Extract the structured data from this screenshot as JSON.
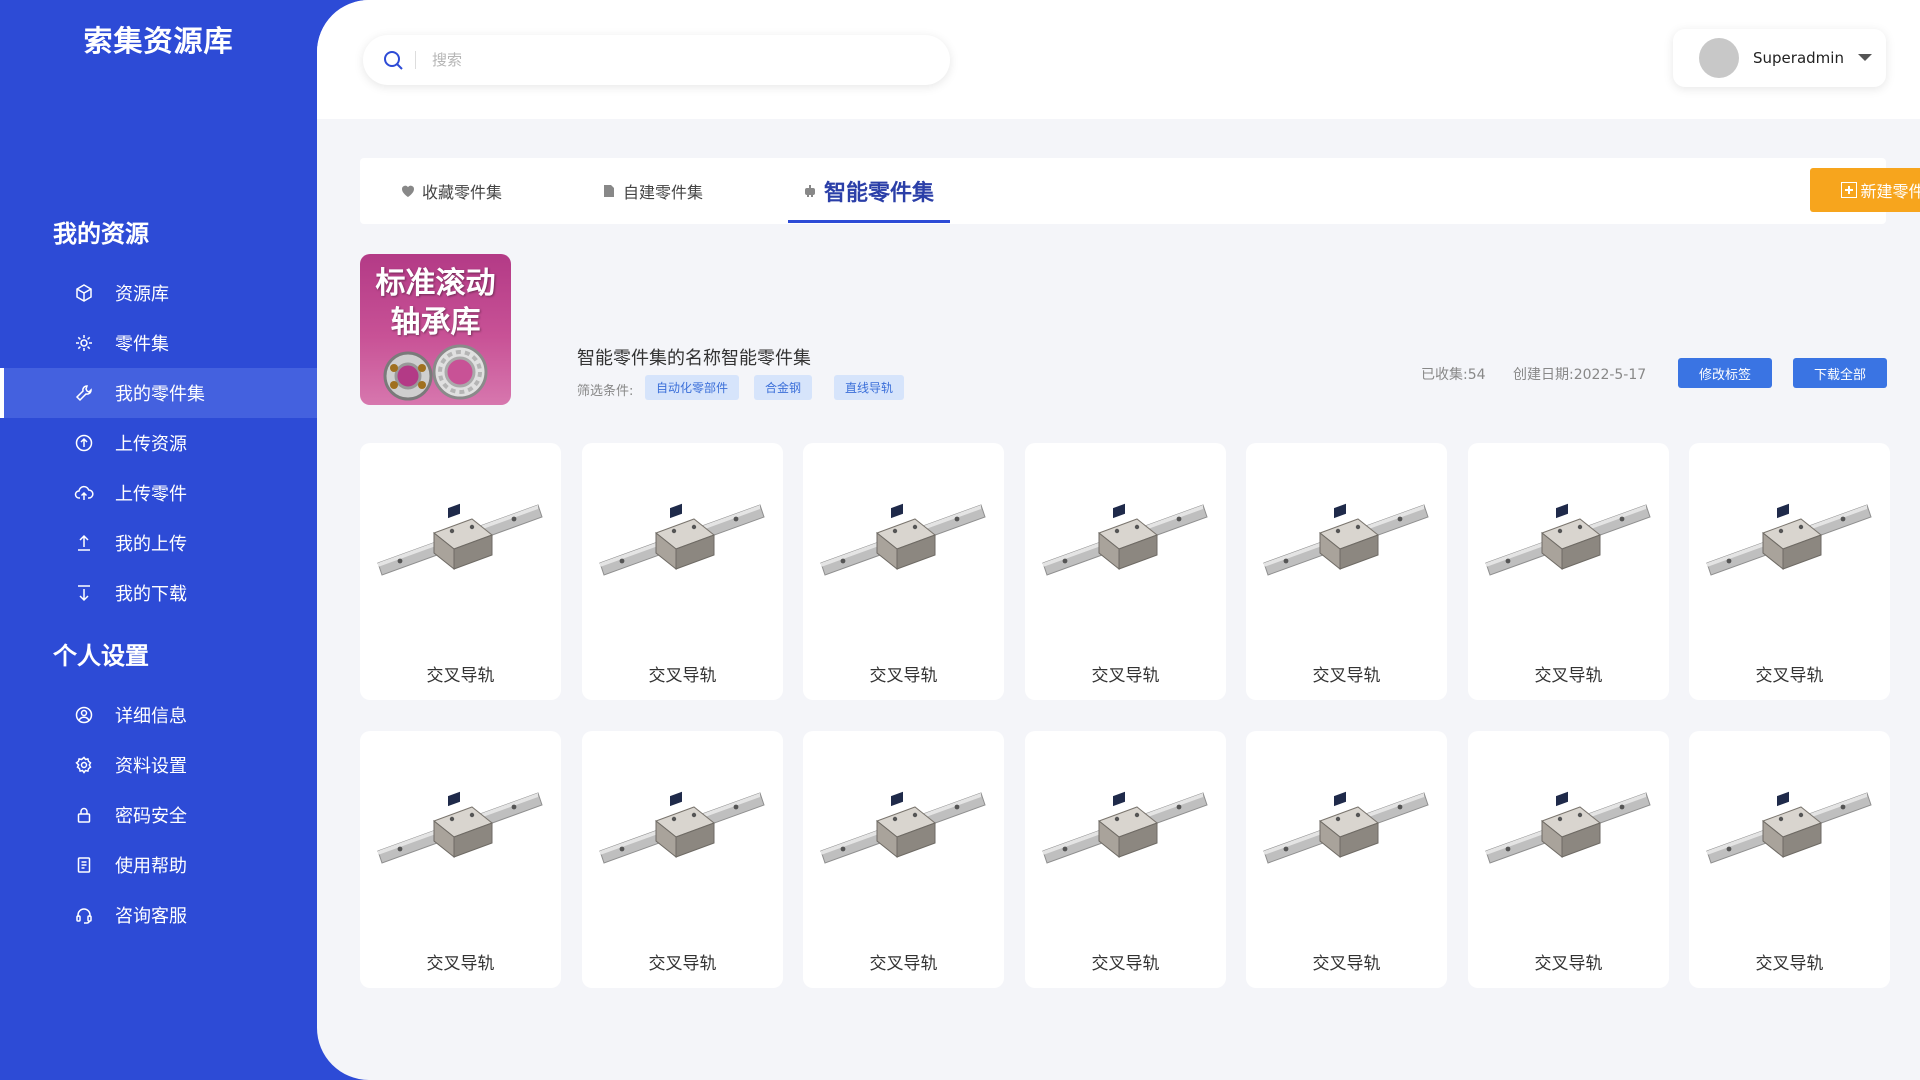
{
  "brand": "索集资源库",
  "sidebar": {
    "section1": "我的资源",
    "section2": "个人设置",
    "items": [
      {
        "label": "资源库",
        "icon": "cube-icon"
      },
      {
        "label": "零件集",
        "icon": "gear-icon"
      },
      {
        "label": "我的零件集",
        "icon": "wrench-icon",
        "active": true
      },
      {
        "label": "上传资源",
        "icon": "upload-circle-icon"
      },
      {
        "label": "上传零件",
        "icon": "cloud-upload-icon"
      },
      {
        "label": "我的上传",
        "icon": "arrow-up-icon"
      },
      {
        "label": "我的下载",
        "icon": "arrow-down-icon"
      }
    ],
    "items2": [
      {
        "label": "详细信息",
        "icon": "user-circle-icon"
      },
      {
        "label": "资料设置",
        "icon": "settings-icon"
      },
      {
        "label": "密码安全",
        "icon": "lock-icon"
      },
      {
        "label": "使用帮助",
        "icon": "help-doc-icon"
      },
      {
        "label": "咨询客服",
        "icon": "headset-icon"
      }
    ]
  },
  "search": {
    "placeholder": "搜索"
  },
  "user": {
    "name": "Superadmin"
  },
  "tabs": [
    {
      "label": "收藏零件集",
      "icon": "heart-icon"
    },
    {
      "label": "自建零件集",
      "icon": "folder-icon"
    },
    {
      "label": "智能零件集",
      "icon": "robot-icon",
      "active": true
    }
  ],
  "new_button": "新建零件库",
  "partset": {
    "cover_text_line1": "标准滚动",
    "cover_text_line2": "轴承库",
    "name": "智能零件集的名称智能零件集",
    "filter_label": "筛选条件:",
    "tags": [
      "自动化零部件",
      "合金钢",
      "直线导轨"
    ],
    "collected": "已收集:54",
    "created": "创建日期:2022-5-17",
    "edit_tags": "修改标签",
    "download_all": "下载全部"
  },
  "parts": [
    "交叉导轨",
    "交叉导轨",
    "交叉导轨",
    "交叉导轨",
    "交叉导轨",
    "交叉导轨",
    "交叉导轨",
    "交叉导轨",
    "交叉导轨",
    "交叉导轨",
    "交叉导轨",
    "交叉导轨",
    "交叉导轨",
    "交叉导轨"
  ],
  "colors": {
    "sidebar": "#2d4bd6",
    "accent": "#f7a51d",
    "button_blue": "#3a74e3",
    "cover": "#c85296"
  }
}
